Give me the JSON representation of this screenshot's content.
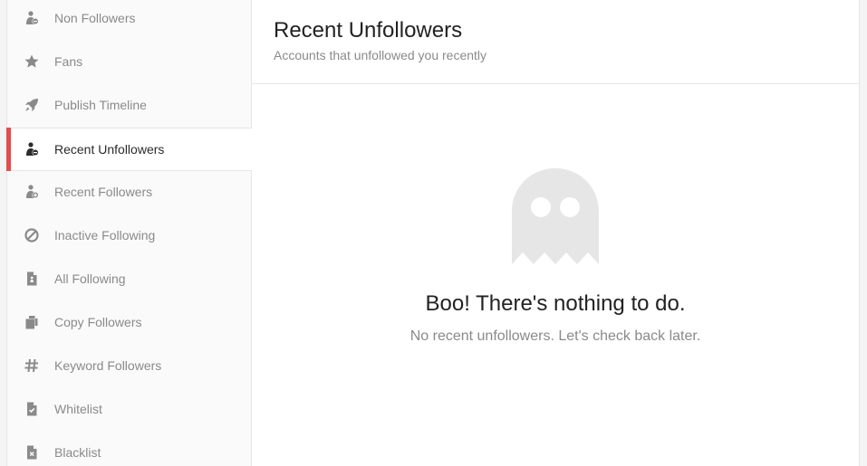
{
  "sidebar": {
    "items": [
      {
        "label": "Non Followers",
        "icon": "user-minus-icon"
      },
      {
        "label": "Fans",
        "icon": "star-icon"
      },
      {
        "label": "Publish Timeline",
        "icon": "rocket-icon"
      },
      {
        "label": "Recent Unfollowers",
        "icon": "user-minus-icon",
        "active": true
      },
      {
        "label": "Recent Followers",
        "icon": "user-plus-icon"
      },
      {
        "label": "Inactive Following",
        "icon": "ban-icon"
      },
      {
        "label": "All Following",
        "icon": "file-user-icon"
      },
      {
        "label": "Copy Followers",
        "icon": "copy-icon"
      },
      {
        "label": "Keyword Followers",
        "icon": "hashtag-icon"
      },
      {
        "label": "Whitelist",
        "icon": "file-check-icon"
      },
      {
        "label": "Blacklist",
        "icon": "file-x-icon"
      }
    ]
  },
  "header": {
    "title": "Recent Unfollowers",
    "subtitle": "Accounts that unfollowed you recently"
  },
  "empty_state": {
    "icon": "ghost-icon",
    "title": "Boo! There's nothing to do.",
    "message": "No recent unfollowers. Let's check back later."
  },
  "colors": {
    "accent": "#e04e4e",
    "ghost": "#e6e6e6",
    "icon_muted": "#8a8a8a",
    "icon_active": "#2b2b2b"
  }
}
